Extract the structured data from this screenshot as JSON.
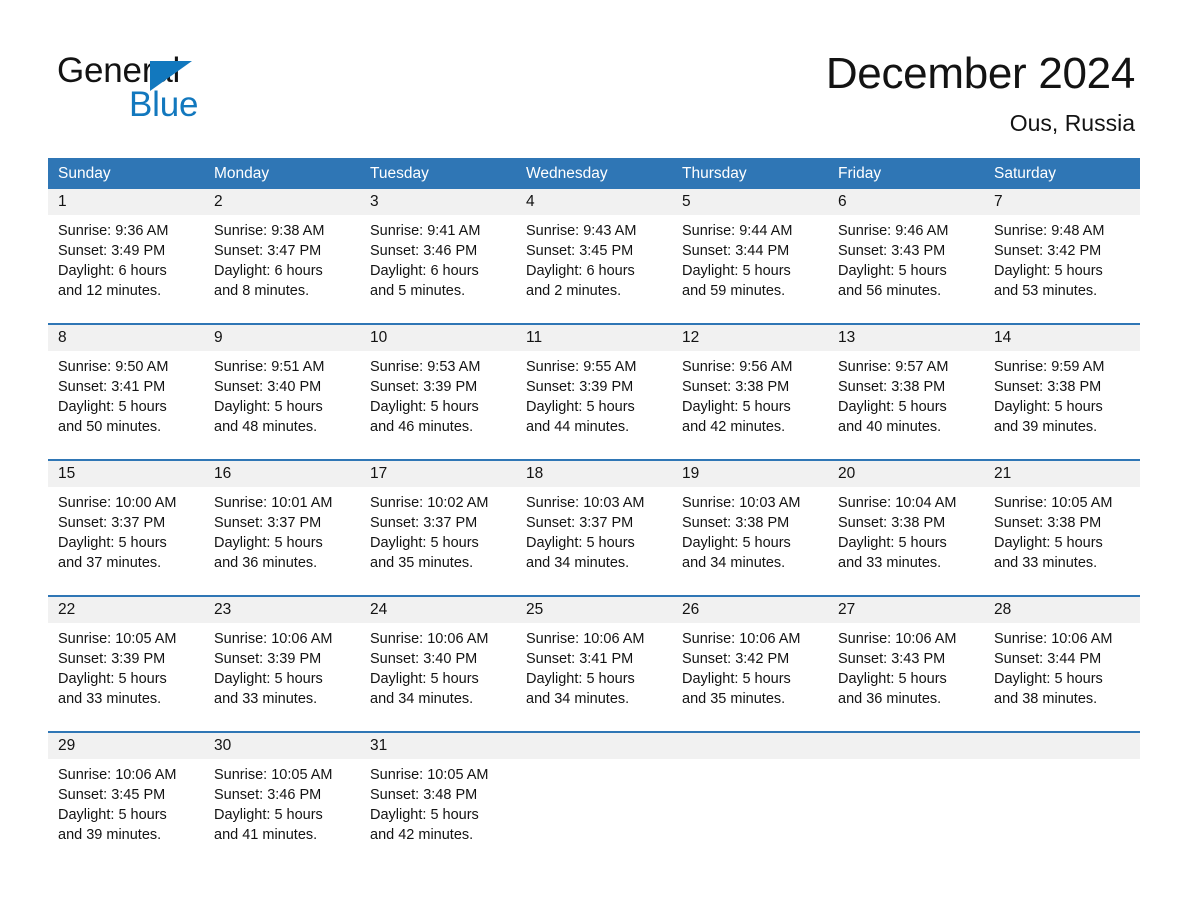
{
  "brand": {
    "word1": "General",
    "word2": "Blue",
    "accent_color": "#1278be"
  },
  "header": {
    "month_title": "December 2024",
    "location": "Ous, Russia"
  },
  "calendar": {
    "header_color": "#2f76b5",
    "daynum_band_color": "#f1f1f1",
    "day_names": [
      "Sunday",
      "Monday",
      "Tuesday",
      "Wednesday",
      "Thursday",
      "Friday",
      "Saturday"
    ],
    "weeks": [
      [
        {
          "day": "1",
          "sunrise": "Sunrise: 9:36 AM",
          "sunset": "Sunset: 3:49 PM",
          "daylight_1": "Daylight: 6 hours",
          "daylight_2": "and 12 minutes."
        },
        {
          "day": "2",
          "sunrise": "Sunrise: 9:38 AM",
          "sunset": "Sunset: 3:47 PM",
          "daylight_1": "Daylight: 6 hours",
          "daylight_2": "and 8 minutes."
        },
        {
          "day": "3",
          "sunrise": "Sunrise: 9:41 AM",
          "sunset": "Sunset: 3:46 PM",
          "daylight_1": "Daylight: 6 hours",
          "daylight_2": "and 5 minutes."
        },
        {
          "day": "4",
          "sunrise": "Sunrise: 9:43 AM",
          "sunset": "Sunset: 3:45 PM",
          "daylight_1": "Daylight: 6 hours",
          "daylight_2": "and 2 minutes."
        },
        {
          "day": "5",
          "sunrise": "Sunrise: 9:44 AM",
          "sunset": "Sunset: 3:44 PM",
          "daylight_1": "Daylight: 5 hours",
          "daylight_2": "and 59 minutes."
        },
        {
          "day": "6",
          "sunrise": "Sunrise: 9:46 AM",
          "sunset": "Sunset: 3:43 PM",
          "daylight_1": "Daylight: 5 hours",
          "daylight_2": "and 56 minutes."
        },
        {
          "day": "7",
          "sunrise": "Sunrise: 9:48 AM",
          "sunset": "Sunset: 3:42 PM",
          "daylight_1": "Daylight: 5 hours",
          "daylight_2": "and 53 minutes."
        }
      ],
      [
        {
          "day": "8",
          "sunrise": "Sunrise: 9:50 AM",
          "sunset": "Sunset: 3:41 PM",
          "daylight_1": "Daylight: 5 hours",
          "daylight_2": "and 50 minutes."
        },
        {
          "day": "9",
          "sunrise": "Sunrise: 9:51 AM",
          "sunset": "Sunset: 3:40 PM",
          "daylight_1": "Daylight: 5 hours",
          "daylight_2": "and 48 minutes."
        },
        {
          "day": "10",
          "sunrise": "Sunrise: 9:53 AM",
          "sunset": "Sunset: 3:39 PM",
          "daylight_1": "Daylight: 5 hours",
          "daylight_2": "and 46 minutes."
        },
        {
          "day": "11",
          "sunrise": "Sunrise: 9:55 AM",
          "sunset": "Sunset: 3:39 PM",
          "daylight_1": "Daylight: 5 hours",
          "daylight_2": "and 44 minutes."
        },
        {
          "day": "12",
          "sunrise": "Sunrise: 9:56 AM",
          "sunset": "Sunset: 3:38 PM",
          "daylight_1": "Daylight: 5 hours",
          "daylight_2": "and 42 minutes."
        },
        {
          "day": "13",
          "sunrise": "Sunrise: 9:57 AM",
          "sunset": "Sunset: 3:38 PM",
          "daylight_1": "Daylight: 5 hours",
          "daylight_2": "and 40 minutes."
        },
        {
          "day": "14",
          "sunrise": "Sunrise: 9:59 AM",
          "sunset": "Sunset: 3:38 PM",
          "daylight_1": "Daylight: 5 hours",
          "daylight_2": "and 39 minutes."
        }
      ],
      [
        {
          "day": "15",
          "sunrise": "Sunrise: 10:00 AM",
          "sunset": "Sunset: 3:37 PM",
          "daylight_1": "Daylight: 5 hours",
          "daylight_2": "and 37 minutes."
        },
        {
          "day": "16",
          "sunrise": "Sunrise: 10:01 AM",
          "sunset": "Sunset: 3:37 PM",
          "daylight_1": "Daylight: 5 hours",
          "daylight_2": "and 36 minutes."
        },
        {
          "day": "17",
          "sunrise": "Sunrise: 10:02 AM",
          "sunset": "Sunset: 3:37 PM",
          "daylight_1": "Daylight: 5 hours",
          "daylight_2": "and 35 minutes."
        },
        {
          "day": "18",
          "sunrise": "Sunrise: 10:03 AM",
          "sunset": "Sunset: 3:37 PM",
          "daylight_1": "Daylight: 5 hours",
          "daylight_2": "and 34 minutes."
        },
        {
          "day": "19",
          "sunrise": "Sunrise: 10:03 AM",
          "sunset": "Sunset: 3:38 PM",
          "daylight_1": "Daylight: 5 hours",
          "daylight_2": "and 34 minutes."
        },
        {
          "day": "20",
          "sunrise": "Sunrise: 10:04 AM",
          "sunset": "Sunset: 3:38 PM",
          "daylight_1": "Daylight: 5 hours",
          "daylight_2": "and 33 minutes."
        },
        {
          "day": "21",
          "sunrise": "Sunrise: 10:05 AM",
          "sunset": "Sunset: 3:38 PM",
          "daylight_1": "Daylight: 5 hours",
          "daylight_2": "and 33 minutes."
        }
      ],
      [
        {
          "day": "22",
          "sunrise": "Sunrise: 10:05 AM",
          "sunset": "Sunset: 3:39 PM",
          "daylight_1": "Daylight: 5 hours",
          "daylight_2": "and 33 minutes."
        },
        {
          "day": "23",
          "sunrise": "Sunrise: 10:06 AM",
          "sunset": "Sunset: 3:39 PM",
          "daylight_1": "Daylight: 5 hours",
          "daylight_2": "and 33 minutes."
        },
        {
          "day": "24",
          "sunrise": "Sunrise: 10:06 AM",
          "sunset": "Sunset: 3:40 PM",
          "daylight_1": "Daylight: 5 hours",
          "daylight_2": "and 34 minutes."
        },
        {
          "day": "25",
          "sunrise": "Sunrise: 10:06 AM",
          "sunset": "Sunset: 3:41 PM",
          "daylight_1": "Daylight: 5 hours",
          "daylight_2": "and 34 minutes."
        },
        {
          "day": "26",
          "sunrise": "Sunrise: 10:06 AM",
          "sunset": "Sunset: 3:42 PM",
          "daylight_1": "Daylight: 5 hours",
          "daylight_2": "and 35 minutes."
        },
        {
          "day": "27",
          "sunrise": "Sunrise: 10:06 AM",
          "sunset": "Sunset: 3:43 PM",
          "daylight_1": "Daylight: 5 hours",
          "daylight_2": "and 36 minutes."
        },
        {
          "day": "28",
          "sunrise": "Sunrise: 10:06 AM",
          "sunset": "Sunset: 3:44 PM",
          "daylight_1": "Daylight: 5 hours",
          "daylight_2": "and 38 minutes."
        }
      ],
      [
        {
          "day": "29",
          "sunrise": "Sunrise: 10:06 AM",
          "sunset": "Sunset: 3:45 PM",
          "daylight_1": "Daylight: 5 hours",
          "daylight_2": "and 39 minutes."
        },
        {
          "day": "30",
          "sunrise": "Sunrise: 10:05 AM",
          "sunset": "Sunset: 3:46 PM",
          "daylight_1": "Daylight: 5 hours",
          "daylight_2": "and 41 minutes."
        },
        {
          "day": "31",
          "sunrise": "Sunrise: 10:05 AM",
          "sunset": "Sunset: 3:48 PM",
          "daylight_1": "Daylight: 5 hours",
          "daylight_2": "and 42 minutes."
        },
        {
          "day": "",
          "sunrise": "",
          "sunset": "",
          "daylight_1": "",
          "daylight_2": ""
        },
        {
          "day": "",
          "sunrise": "",
          "sunset": "",
          "daylight_1": "",
          "daylight_2": ""
        },
        {
          "day": "",
          "sunrise": "",
          "sunset": "",
          "daylight_1": "",
          "daylight_2": ""
        },
        {
          "day": "",
          "sunrise": "",
          "sunset": "",
          "daylight_1": "",
          "daylight_2": ""
        }
      ]
    ]
  }
}
